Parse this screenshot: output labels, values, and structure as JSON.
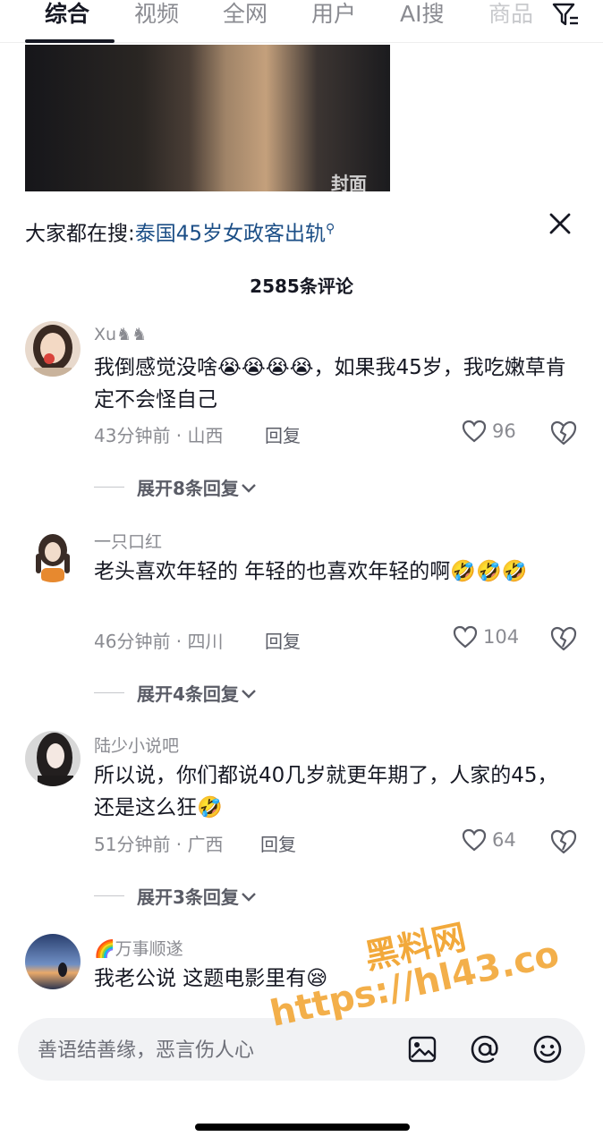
{
  "tabs": [
    "综合",
    "视频",
    "全网",
    "用户",
    "AI搜",
    "商品"
  ],
  "video": {
    "cover_label": "封面"
  },
  "sheet": {
    "search_prefix": "大家都在搜:",
    "search_query": "泰国45岁女政客出轨",
    "comment_count": "2585条评论"
  },
  "comments": [
    {
      "user": "Xu♞♞",
      "text": "我倒感觉没啥😭😭😭😭，如果我45岁，我吃嫩草肯定不会怪自己",
      "meta": "43分钟前 · 山西",
      "reply": "回复",
      "likes": "96",
      "expand": "展开8条回复"
    },
    {
      "user": "一只口红",
      "text": "老头喜欢年轻的 年轻的也喜欢年轻的啊🤣🤣🤣",
      "meta": "46分钟前 · 四川",
      "reply": "回复",
      "likes": "104",
      "expand": "展开4条回复"
    },
    {
      "user": "陆少小说吧",
      "text": "所以说，你们都说40几岁就更年期了，人家的45，还是这么狂🤣",
      "meta": "51分钟前 · 广西",
      "reply": "回复",
      "likes": "64",
      "expand": "展开3条回复"
    },
    {
      "user": "🌈万事顺遂",
      "text": "我老公说 这题电影里有😪"
    }
  ],
  "input": {
    "placeholder": "善语结善缘，恶言伤人心"
  },
  "watermark": {
    "line1": "黑料网",
    "line2": "https://hl43.co"
  },
  "colors": {
    "link": "#1b4e86",
    "watermark": "#f2a93b"
  }
}
